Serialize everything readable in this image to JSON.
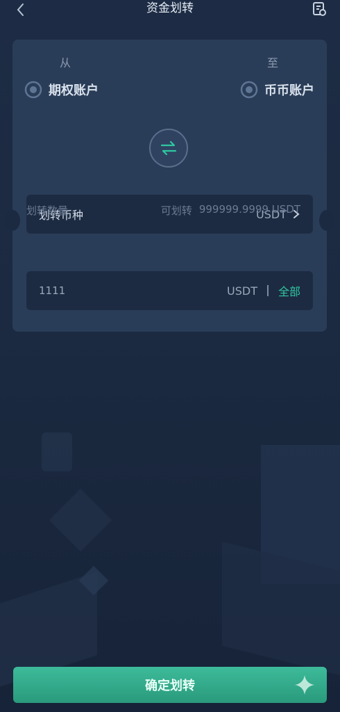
{
  "header": {
    "title": "资金划转"
  },
  "transfer": {
    "from_label": "从",
    "to_label": "至",
    "from_account": "期权账户",
    "to_account": "币币账户"
  },
  "coin_row": {
    "label": "划转币种",
    "value": "USDT"
  },
  "quantity_row": {
    "label": "划转数量",
    "available_label": "可划转",
    "available_value": "999999.9999 USDT"
  },
  "amount_input": {
    "value": "1111",
    "unit": "USDT",
    "all_label": "全部"
  },
  "confirm_button": {
    "label": "确定划转"
  },
  "colors": {
    "accent": "#2fc7a0",
    "background": "#1b2a41",
    "card": "#2a3d58"
  }
}
